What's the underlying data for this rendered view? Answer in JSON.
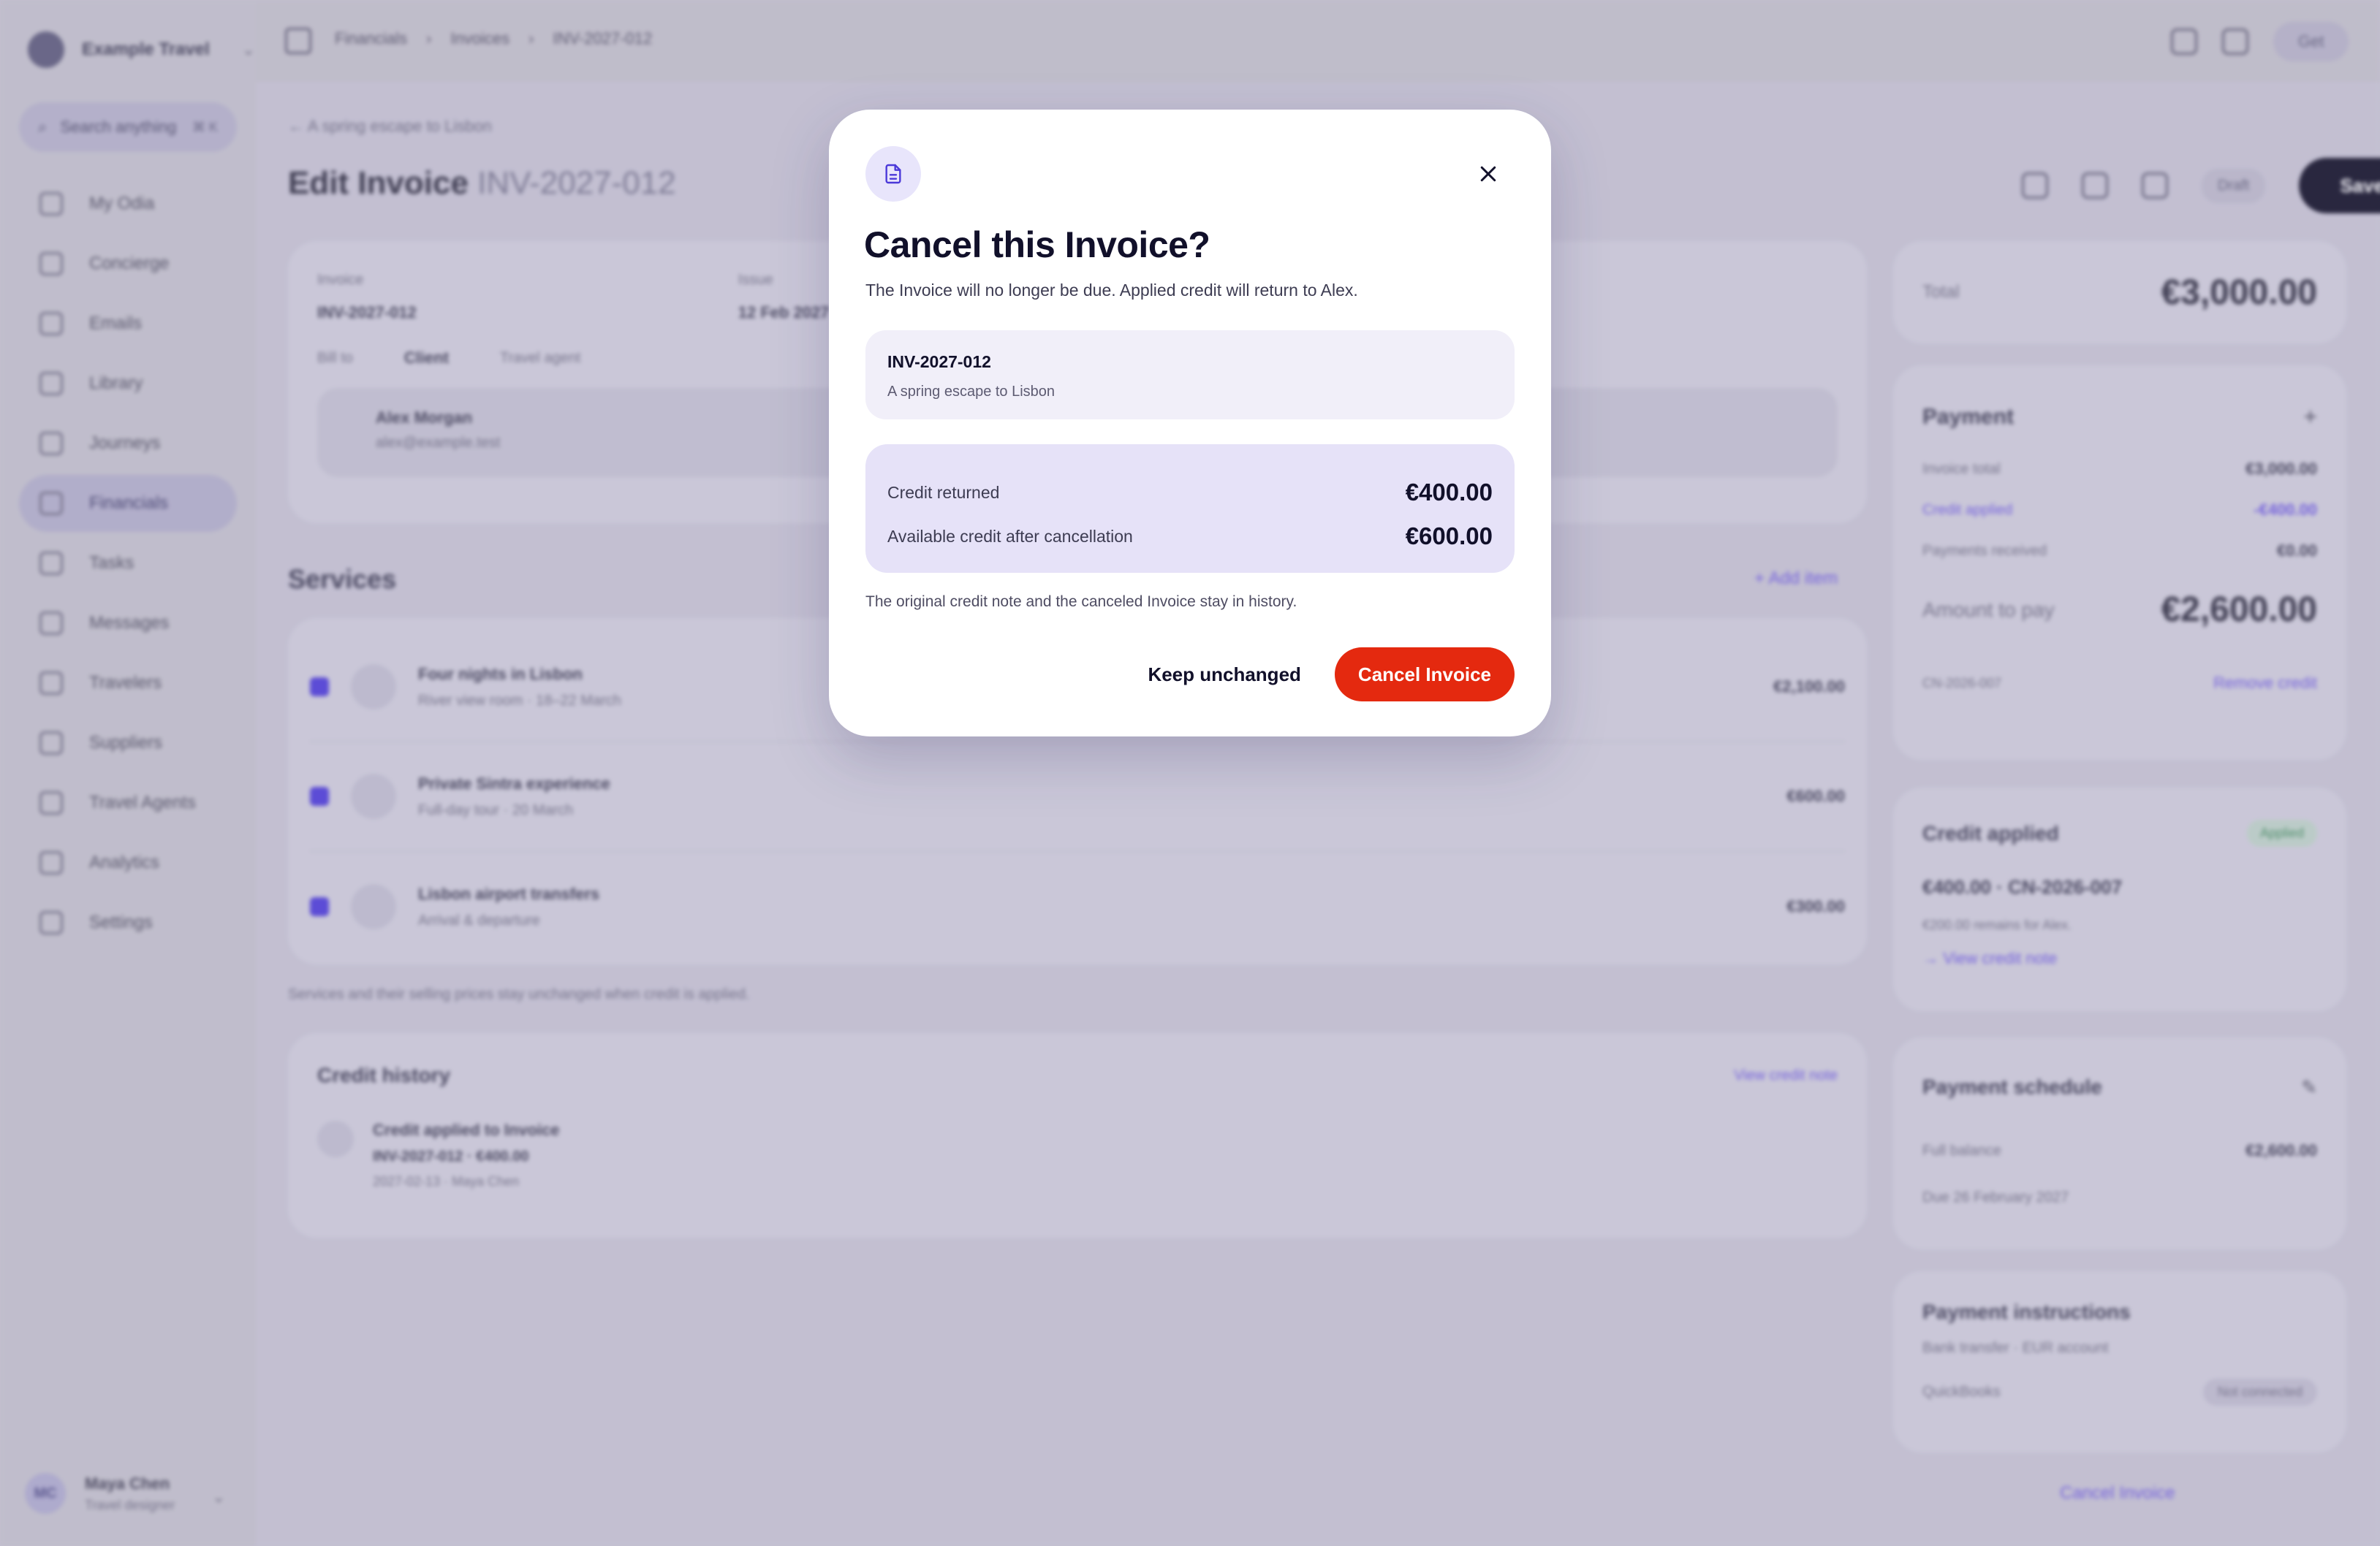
{
  "workspace": {
    "name": "Example Travel"
  },
  "search": {
    "placeholder": "Search anything",
    "shortcut": "⌘ K"
  },
  "sidebar": {
    "items": [
      {
        "label": "My Odia"
      },
      {
        "label": "Concierge"
      },
      {
        "label": "Emails"
      },
      {
        "label": "Library"
      },
      {
        "label": "Journeys"
      },
      {
        "label": "Financials"
      },
      {
        "label": "Tasks"
      },
      {
        "label": "Messages"
      },
      {
        "label": "Travelers"
      },
      {
        "label": "Suppliers"
      },
      {
        "label": "Travel Agents"
      },
      {
        "label": "Analytics"
      },
      {
        "label": "Settings"
      }
    ],
    "user": {
      "initials": "MC",
      "name": "Maya Chen",
      "role": "Travel designer"
    }
  },
  "breadcrumb": {
    "items": [
      "Financials",
      "Invoices",
      "INV-2027-012"
    ]
  },
  "topbar": {
    "get_label": "Get"
  },
  "page": {
    "back_link": "A spring escape to Lisbon",
    "title": "Edit Invoice",
    "title_number": "INV-2027-012",
    "draft_badge": "Draft",
    "save_label": "Save"
  },
  "invoice_card": {
    "invoice_label": "Invoice",
    "invoice_value": "INV-2027-012",
    "issue_label": "Issue",
    "issue_value": "12 Feb 2027",
    "bill_to_label": "Bill to",
    "client_option": "Client",
    "agent_option": "Travel agent",
    "client_name": "Alex Morgan",
    "client_email": "alex@example.test"
  },
  "services": {
    "title": "Services",
    "add_label": "Add item",
    "items": [
      {
        "name": "Four nights in Lisbon",
        "detail": "River view room · 18–22 March",
        "price": "€2,100.00"
      },
      {
        "name": "Private Sintra experience",
        "detail": "Full-day tour · 20 March",
        "price": "€600.00"
      },
      {
        "name": "Lisbon airport transfers",
        "detail": "Arrival & departure",
        "price": "€300.00"
      }
    ],
    "note": "Services and their selling prices stay unchanged when credit is applied."
  },
  "credit_history": {
    "title": "Credit history",
    "view_link": "View credit note",
    "entry_title": "Credit applied to Invoice",
    "entry_detail": "INV-2027-012 · €400.00",
    "entry_meta": "2027-02-13 · Maya Chen"
  },
  "summary": {
    "total_label": "Total",
    "total_value": "€3,000.00",
    "payment_title": "Payment",
    "invoice_total_label": "Invoice total",
    "invoice_total_value": "€3,000.00",
    "credit_applied_label": "Credit applied",
    "credit_applied_value": "-€400.00",
    "payments_received_label": "Payments received",
    "payments_received_value": "€0.00",
    "amount_to_pay_label": "Amount to pay",
    "amount_to_pay_value": "€2,600.00",
    "credit_note_ref": "CN-2026-007",
    "remove_credit": "Remove credit"
  },
  "credit_card": {
    "title": "Credit applied",
    "badge": "Applied",
    "amount_line": "€400.00 · CN-2026-007",
    "remaining": "€200.00 remains for Alex.",
    "view_link": "View credit note"
  },
  "schedule": {
    "title": "Payment schedule",
    "row_label": "Full balance",
    "row_value": "€2,600.00",
    "due": "Due 26 February 2027"
  },
  "instructions": {
    "title": "Payment instructions",
    "detail": "Bank transfer · EUR account",
    "integration": "QuickBooks",
    "integration_status": "Not connected"
  },
  "cancel_link": "Cancel Invoice",
  "modal": {
    "title": "Cancel this Invoice?",
    "subtitle": "The Invoice will no longer be due. Applied credit will return to Alex.",
    "invoice_number": "INV-2027-012",
    "invoice_name": "A spring escape to Lisbon",
    "credit_returned_label": "Credit returned",
    "credit_returned_value": "€400.00",
    "available_label": "Available credit after cancellation",
    "available_value": "€600.00",
    "note": "The original credit note and the canceled Invoice stay in history.",
    "keep_label": "Keep unchanged",
    "cancel_label": "Cancel Invoice"
  },
  "colors": {
    "accent": "#4b39d9",
    "danger": "#e4290f",
    "dark_button": "#0d0c22"
  }
}
